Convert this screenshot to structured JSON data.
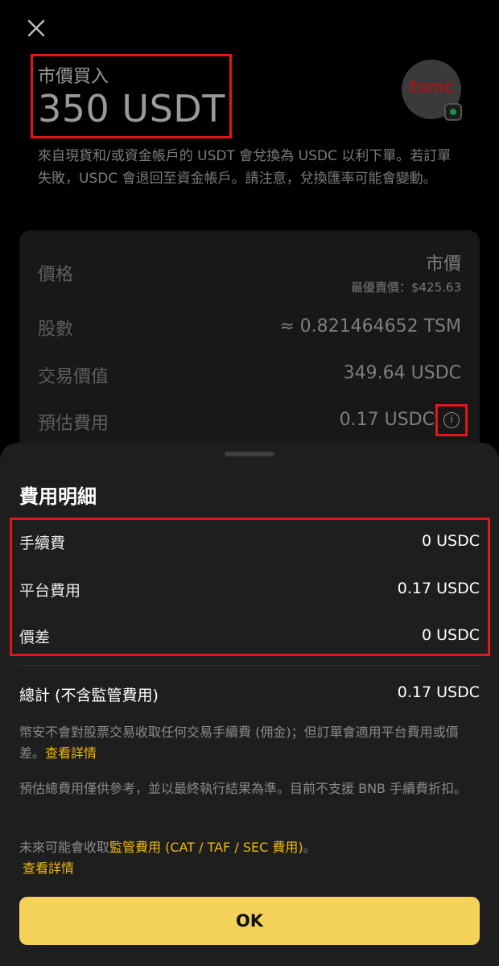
{
  "header": {
    "order_type": "市價買入",
    "amount": "350 USDT",
    "logo_text": "tsmc"
  },
  "notice": "來自現貨和/或資金帳戶的 USDT 會兌換為 USDC 以利下單。若訂單失敗，USDC 會退回至資金帳戶。請注意，兌換匯率可能會變動。",
  "order_card": {
    "price_label": "價格",
    "price_value": "市價",
    "best_price": "最優賣價：$425.63",
    "shares_label": "股數",
    "shares_value": "≈ 0.821464652 TSM",
    "trade_value_label": "交易價值",
    "trade_value": "349.64 USDC",
    "est_fee_label": "預估費用",
    "est_fee_value": "0.17 USDC",
    "info_glyph": "i"
  },
  "fee_sheet": {
    "title": "費用明細",
    "items": [
      {
        "label": "手續費",
        "value": "0 USDC"
      },
      {
        "label": "平台費用",
        "value": "0.17 USDC"
      },
      {
        "label": "價差",
        "value": "0 USDC"
      }
    ],
    "total_label": "總計 (不含監管費用)",
    "total_value": "0.17 USDC",
    "para1_text": "幣安不會對股票交易收取任何交易手續費 (佣金)；但訂單會適用平台費用或價差。",
    "para1_link": "查看詳情",
    "para2_text": "預估總費用僅供參考，並以最終執行結果為準。目前不支援 BNB 手續費折扣。",
    "para3_text": "未來可能會收取",
    "para3_link1": "監管費用 (CAT / TAF / SEC 費用)",
    "para3_suffix": "。",
    "para3_link2": "查看詳情",
    "ok_label": "OK"
  },
  "colors": {
    "accent_yellow": "#f0b90b",
    "button_yellow": "#f5d35b",
    "highlight_red": "#e0171b"
  },
  "icons": {
    "close": "close-icon",
    "info": "info-icon"
  }
}
